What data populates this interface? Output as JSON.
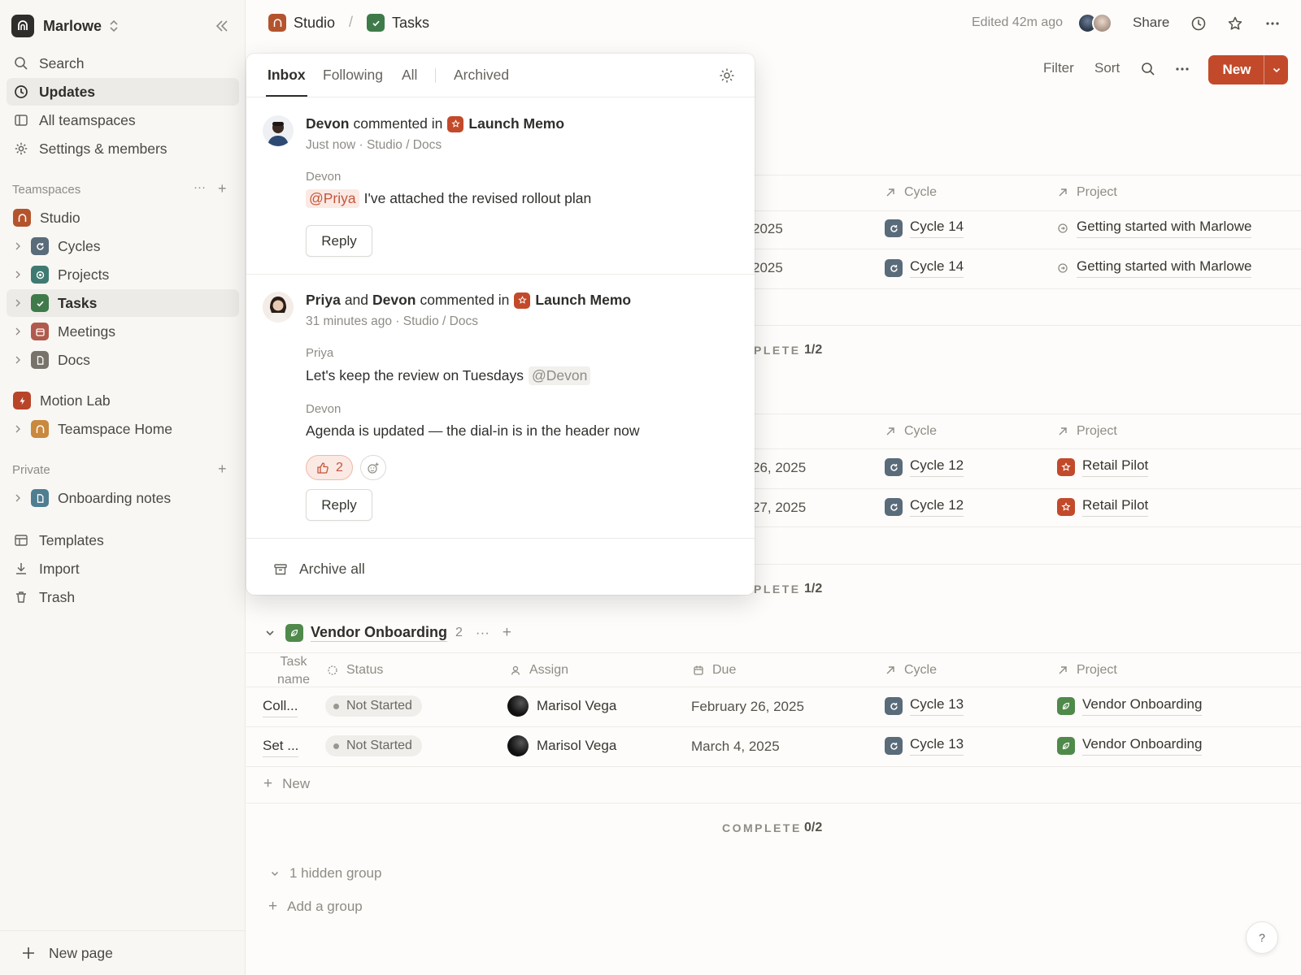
{
  "workspace": {
    "name": "Marlowe"
  },
  "sidebar": {
    "nav": [
      {
        "label": "Search"
      },
      {
        "label": "Updates"
      },
      {
        "label": "All teamspaces"
      },
      {
        "label": "Settings & members"
      }
    ],
    "teamspaces_heading": "Teamspaces",
    "teamspace_items": [
      {
        "label": "Studio"
      },
      {
        "label": "Cycles"
      },
      {
        "label": "Projects"
      },
      {
        "label": "Tasks"
      },
      {
        "label": "Meetings"
      },
      {
        "label": "Docs"
      },
      {
        "label": "Motion Lab"
      },
      {
        "label": "Teamspace Home"
      }
    ],
    "private_heading": "Private",
    "private_items": [
      {
        "label": "Onboarding notes"
      }
    ],
    "bottom": [
      {
        "label": "Templates"
      },
      {
        "label": "Import"
      },
      {
        "label": "Trash"
      }
    ],
    "new_page": "New page"
  },
  "header": {
    "breadcrumb": [
      "Studio",
      "Tasks"
    ],
    "separator": "/",
    "edited": "Edited 42m ago",
    "share": "Share"
  },
  "toolbar": {
    "filter": "Filter",
    "sort": "Sort",
    "new": "New"
  },
  "inbox": {
    "tabs": [
      "Inbox",
      "Following",
      "All",
      "Archived"
    ],
    "notifications": [
      {
        "actor1": "Devon",
        "verb": "commented in",
        "page": "Launch Memo",
        "meta": "Just now · Studio / Docs",
        "comments": [
          {
            "author": "Devon",
            "mention": "@Priya",
            "text": "I've attached the revised rollout plan"
          }
        ],
        "reply": "Reply"
      },
      {
        "actor1": "Priya",
        "and": "and",
        "actor2": "Devon",
        "verb": "commented in",
        "page": "Launch Memo",
        "meta": "31 minutes ago · Studio / Docs",
        "comments": [
          {
            "author": "Priya",
            "text": "Let's keep the review on Tuesdays",
            "mention": "@Devon"
          },
          {
            "author": "Devon",
            "text": "Agenda is updated — the dial-in is in the header now"
          }
        ],
        "reaction_count": "2",
        "reply": "Reply"
      }
    ],
    "archive_all": "Archive all"
  },
  "table": {
    "col_cycle": "Cycle",
    "col_project": "Project",
    "group1_rows": [
      {
        "due": "2025",
        "cycle": "Cycle 14",
        "project": "Getting started with Marlowe"
      },
      {
        "due": "2025",
        "cycle": "Cycle 14",
        "project": "Getting started with Marlowe"
      }
    ],
    "group1_complete": {
      "label": "PLETE",
      "value": "1/2"
    },
    "group2_rows": [
      {
        "due": "26, 2025",
        "cycle": "Cycle 12",
        "project": "Retail Pilot"
      },
      {
        "due": "27, 2025",
        "cycle": "Cycle 12",
        "project": "Retail Pilot"
      }
    ],
    "group2_complete": {
      "label": "PLETE",
      "value": "1/2"
    },
    "group3": {
      "title": "Vendor Onboarding",
      "count": "2",
      "columns": {
        "task": "Task name",
        "status": "Status",
        "assign": "Assign",
        "due": "Due",
        "cycle": "Cycle",
        "project": "Project"
      },
      "rows": [
        {
          "task": "Coll...",
          "status": "Not Started",
          "assignee": "Marisol Vega",
          "due": "February 26, 2025",
          "cycle": "Cycle 13",
          "project": "Vendor Onboarding"
        },
        {
          "task": "Set ...",
          "status": "Not Started",
          "assignee": "Marisol Vega",
          "due": "March 4, 2025",
          "cycle": "Cycle 13",
          "project": "Vendor Onboarding"
        }
      ],
      "new_row": "New",
      "complete_label": "COMPLETE",
      "complete_value": "0/2"
    },
    "hidden_group": "1 hidden group",
    "add_group": "Add a group"
  },
  "help": "?",
  "colors": {
    "accent": "#c24a2a",
    "studio_icon": "#b4542d",
    "tasks_icon": "#3f7a4a",
    "cycle_icon": "#5a6b7a"
  },
  "icons": [
    "search-icon",
    "clock-icon",
    "teamspaces-icon",
    "gear-icon",
    "chevron-right-icon",
    "star-icon",
    "more-icon",
    "plus-icon",
    "template-icon",
    "import-icon",
    "trash-icon",
    "archive-icon",
    "thumbs-up-icon",
    "add-reaction-icon"
  ]
}
